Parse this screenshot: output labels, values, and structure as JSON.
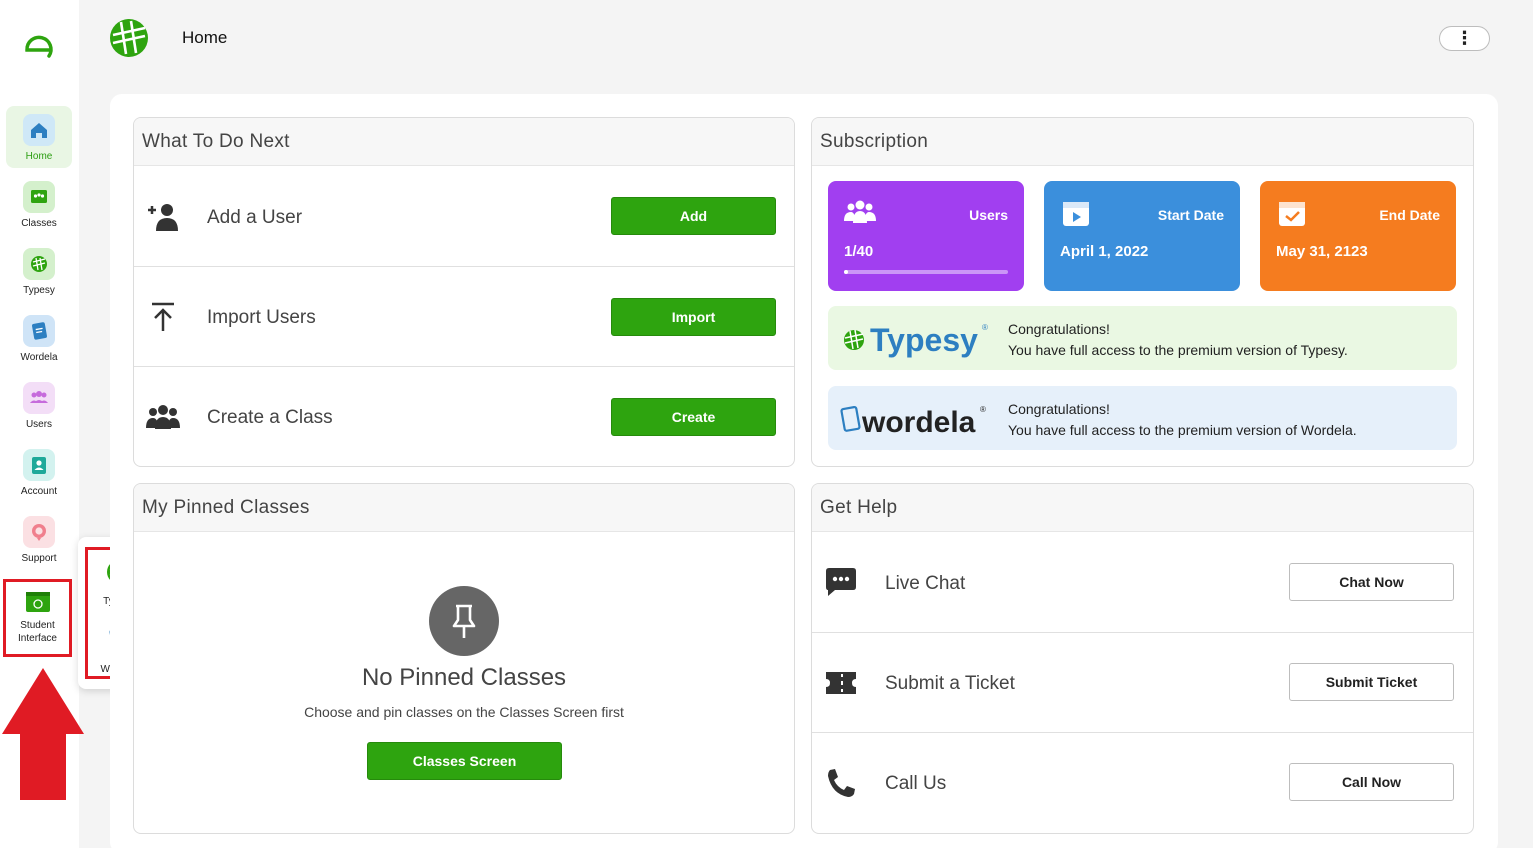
{
  "sidebar": {
    "items": [
      {
        "label": "Home"
      },
      {
        "label": "Classes"
      },
      {
        "label": "Typesy"
      },
      {
        "label": "Wordela"
      },
      {
        "label": "Users"
      },
      {
        "label": "Account"
      },
      {
        "label": "Support"
      }
    ],
    "student_interface": {
      "line1": "Student",
      "line2": "Interface"
    }
  },
  "popup": {
    "items": [
      {
        "label": "Typesy"
      },
      {
        "label": "Wordela"
      }
    ]
  },
  "header": {
    "title": "Home",
    "more_label": "⋮"
  },
  "todo": {
    "title": "What To Do Next",
    "rows": [
      {
        "label": "Add a User",
        "button": "Add"
      },
      {
        "label": "Import Users",
        "button": "Import"
      },
      {
        "label": "Create a Class",
        "button": "Create"
      }
    ]
  },
  "subscription": {
    "title": "Subscription",
    "tiles": [
      {
        "label": "Users",
        "value": "1/40",
        "progress": 0.025,
        "color": "#a13ff0"
      },
      {
        "label": "Start Date",
        "value": "April 1, 2022",
        "color": "#3b8fdc"
      },
      {
        "label": "End Date",
        "value": "May 31, 2123",
        "color": "#f57c1f"
      }
    ],
    "banners": [
      {
        "product": "Typesy",
        "line1": "Congratulations!",
        "line2": "You have full access to the premium version of Typesy.",
        "bg": "#eaf8e3"
      },
      {
        "product": "wordela",
        "line1": "Congratulations!",
        "line2": "You have full access to the premium version of Wordela.",
        "bg": "#e6f0fa"
      }
    ]
  },
  "pinned": {
    "title": "My Pinned Classes",
    "empty_title": "No Pinned Classes",
    "empty_sub": "Choose and pin classes on the Classes Screen first",
    "button": "Classes Screen"
  },
  "help": {
    "title": "Get Help",
    "rows": [
      {
        "label": "Live Chat",
        "button": "Chat Now"
      },
      {
        "label": "Submit a Ticket",
        "button": "Submit Ticket"
      },
      {
        "label": "Call Us",
        "button": "Call Now"
      }
    ]
  },
  "colors": {
    "accent_green": "#2ea40f",
    "highlight_red": "#e01b24"
  }
}
